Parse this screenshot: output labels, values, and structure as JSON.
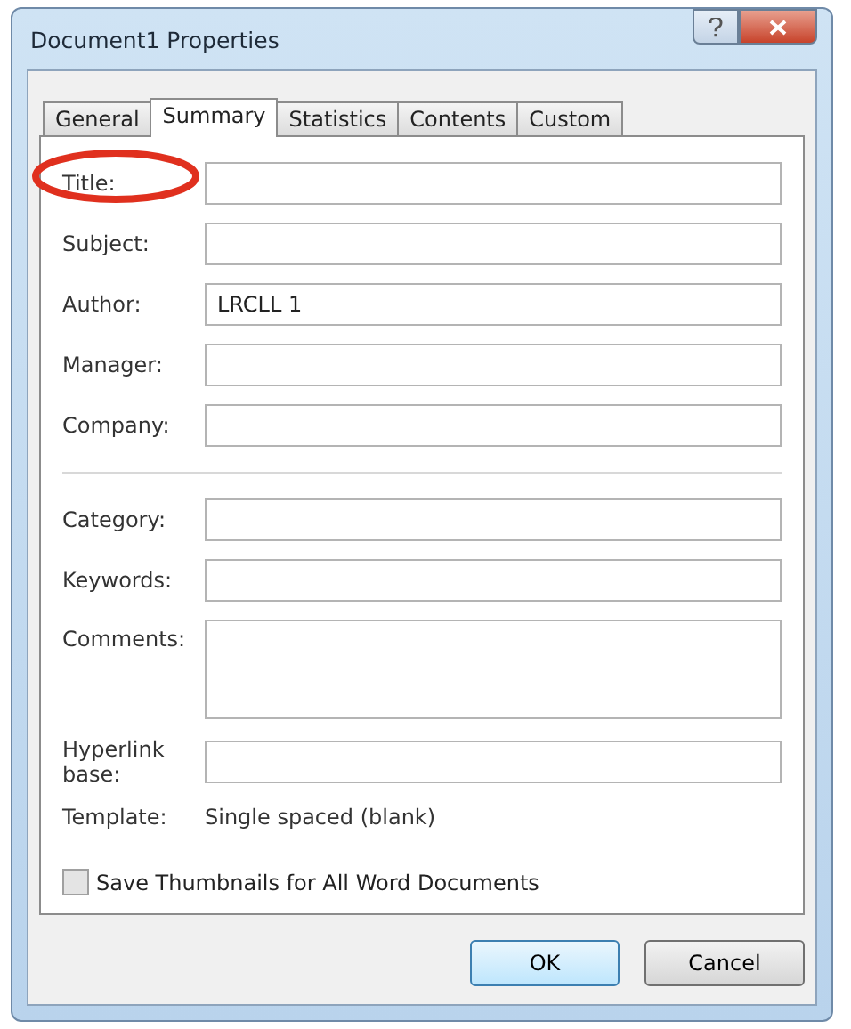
{
  "window": {
    "title": "Document1 Properties"
  },
  "tabs": [
    {
      "label": "General",
      "selected": false
    },
    {
      "label": "Summary",
      "selected": true
    },
    {
      "label": "Statistics",
      "selected": false
    },
    {
      "label": "Contents",
      "selected": false
    },
    {
      "label": "Custom",
      "selected": false
    }
  ],
  "groups": [
    [
      {
        "kind": "text",
        "label": "Title:",
        "highlighted": true
      },
      {
        "kind": "text",
        "label": "Subject:",
        "highlighted": false
      },
      {
        "kind": "text",
        "label": "Author:",
        "value": "LRCLL 1",
        "highlighted": false
      },
      {
        "kind": "text",
        "label": "Manager:",
        "highlighted": false
      },
      {
        "kind": "text",
        "label": "Company:",
        "highlighted": false
      }
    ],
    [
      {
        "kind": "text",
        "label": "Category:",
        "highlighted": false
      },
      {
        "kind": "text",
        "label": "Keywords:",
        "highlighted": false
      },
      {
        "kind": "multiline",
        "label": "Comments:",
        "highlighted": false
      },
      {
        "kind": "text",
        "label": "Hyperlink base:",
        "highlighted": false
      },
      {
        "kind": "static",
        "label": "Template:",
        "value": "Single spaced (blank)",
        "highlighted": false
      }
    ]
  ],
  "save_thumbnails": {
    "label": "Save Thumbnails for All Word Documents",
    "checked": false
  },
  "buttons": [
    {
      "label": "OK",
      "default": true
    },
    {
      "label": "Cancel",
      "default": false
    }
  ]
}
